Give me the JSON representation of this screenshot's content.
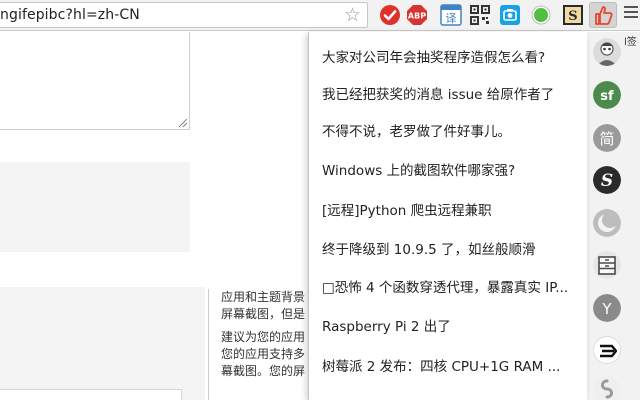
{
  "omnibox": {
    "url": "ngifepibc?hl=zh-CN",
    "star_icon": "bookmark-star-icon"
  },
  "extensions": [
    {
      "name": "checkmark-icon",
      "color": "#e0322b"
    },
    {
      "name": "adblock-plus-icon",
      "label": "ABP",
      "color": "#d7332f"
    },
    {
      "name": "translate-icon",
      "label": "译",
      "color": "#3f82c5"
    },
    {
      "name": "qr-code-icon"
    },
    {
      "name": "screenshot-icon",
      "color": "#1aa0e6"
    },
    {
      "name": "green-circle-icon",
      "color": "#4fbf3f"
    },
    {
      "name": "s-box-icon",
      "label": "S"
    },
    {
      "name": "thumbs-up-icon",
      "color": "#e8452c"
    }
  ],
  "page": {
    "side_text_1": [
      "应用和主题背景",
      "屏幕截图，但是"
    ],
    "side_text_2": [
      "建议为您的应用",
      "您的应用支持多",
      "幕截图。您的屏"
    ],
    "strip_tail": "l签"
  },
  "popup": {
    "items": [
      "大家对公司年会抽奖程序造假怎么看?",
      "我已经把获奖的消息 issue 给原作者了",
      "不得不说，老罗做了件好事儿。",
      "Windows 上的截图软件哪家强?",
      "[远程]Python 爬虫远程兼职",
      "终于降级到 10.9.5 了，如丝般顺滑",
      "□恐怖 4 个函数穿透代理，暴露真实 IP...",
      "Raspberry Pi 2 出了",
      "树莓派 2 发布：四核 CPU+1G RAM ..."
    ]
  },
  "avatars": [
    {
      "name": "user-avatar-icon",
      "color": "#888888"
    },
    {
      "name": "segmentfault-icon",
      "label": "sf",
      "color": "#4c8a4e"
    },
    {
      "name": "jianshu-icon",
      "label": "简",
      "color": "#9a9a9a"
    },
    {
      "name": "s-logo-icon",
      "label": "S",
      "color": "#2b2b2b"
    },
    {
      "name": "moon-icon",
      "color": "#bdbdbd"
    },
    {
      "name": "cabinet-icon",
      "color": "#5a5a5a"
    },
    {
      "name": "y-icon",
      "label": "Y",
      "color": "#8a8a8a"
    },
    {
      "name": "arrow-icon",
      "color": "#111111"
    },
    {
      "name": "swirl-icon",
      "color": "#b0b0b0"
    }
  ]
}
